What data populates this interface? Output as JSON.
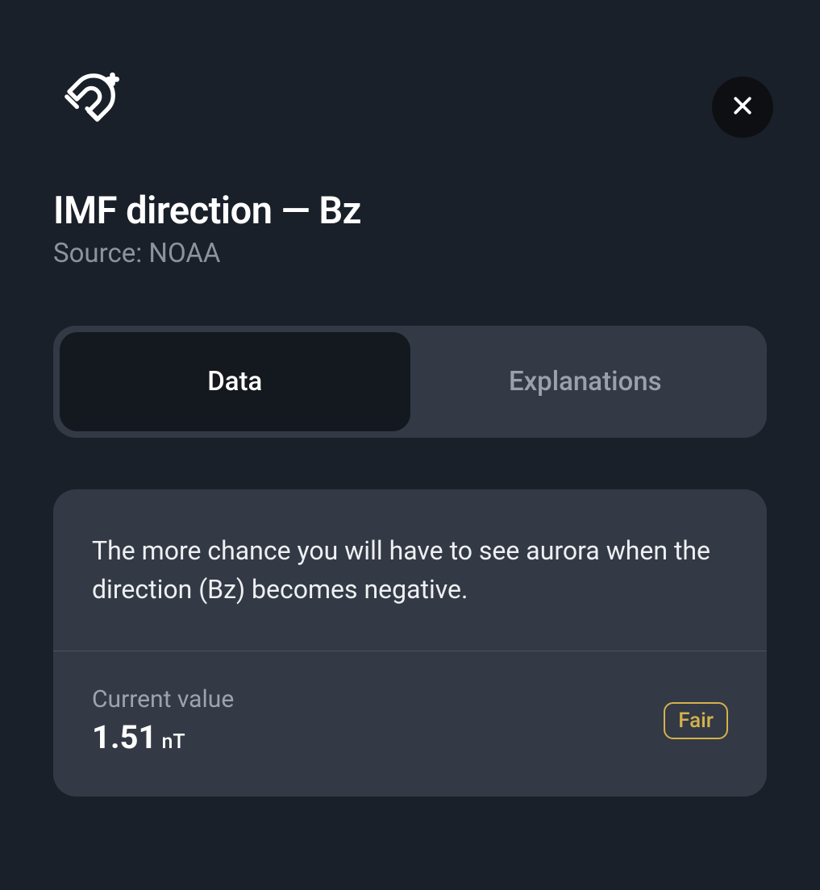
{
  "header": {
    "title": "IMF direction — Bz",
    "source": "Source: NOAA"
  },
  "tabs": [
    {
      "label": "Data"
    },
    {
      "label": "Explanations"
    }
  ],
  "card": {
    "description": "The more chance you will have to see aurora when the direction (Bz) becomes negative.",
    "current_label": "Current value",
    "current_value": "1.51",
    "current_unit": "nT",
    "badge": "Fair"
  }
}
